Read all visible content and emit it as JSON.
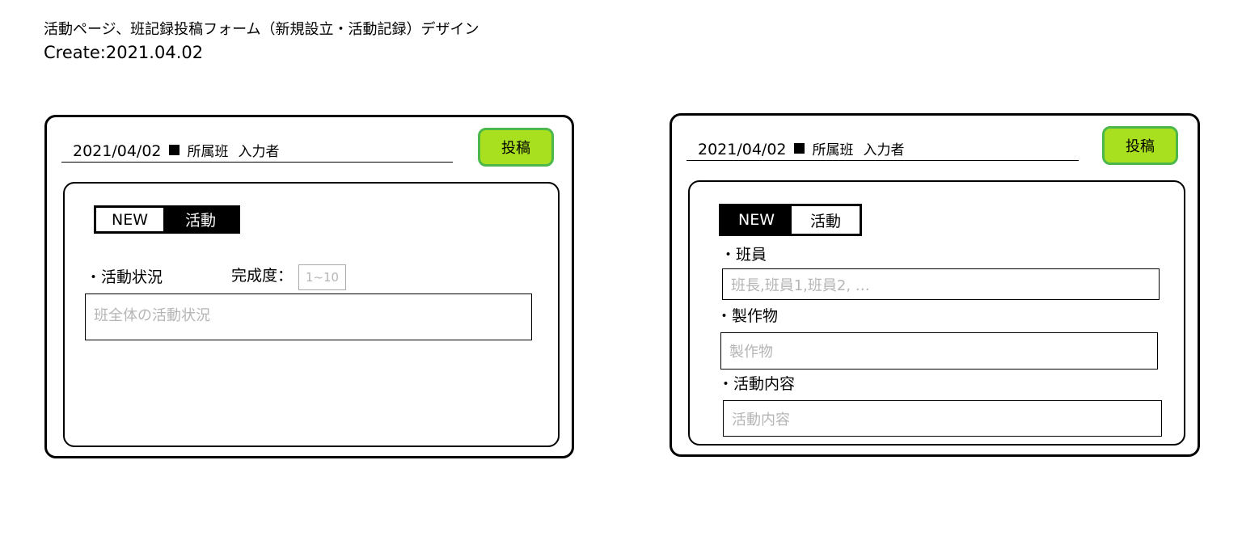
{
  "header": {
    "title": "活動ページ、班記録投稿フォーム（新規設立・活動記録）デザイン",
    "created": "Create:2021.04.02"
  },
  "left_form": {
    "date": "2021/04/02",
    "group_label": "所属班",
    "author_label": "入力者",
    "post_button": "投稿",
    "toggle": {
      "new": "NEW",
      "activity": "活動",
      "selected": "activity"
    },
    "status_label": "・活動状況",
    "completion_label": "完成度：",
    "completion_placeholder": "1~10",
    "status_placeholder": "班全体の活動状況"
  },
  "right_form": {
    "date": "2021/04/02",
    "group_label": "所属班",
    "author_label": "入力者",
    "post_button": "投稿",
    "toggle": {
      "new": "NEW",
      "activity": "活動",
      "selected": "new"
    },
    "members_label": "・班員",
    "members_placeholder": "班長,班員1,班員2, …",
    "product_label": "・製作物",
    "product_placeholder": "製作物",
    "content_label": "・活動内容",
    "content_placeholder": "活動内容"
  },
  "colors": {
    "post_button_fill": "#a8e020",
    "post_button_border": "#4cb84c",
    "placeholder_text": "#b5b5b5"
  }
}
